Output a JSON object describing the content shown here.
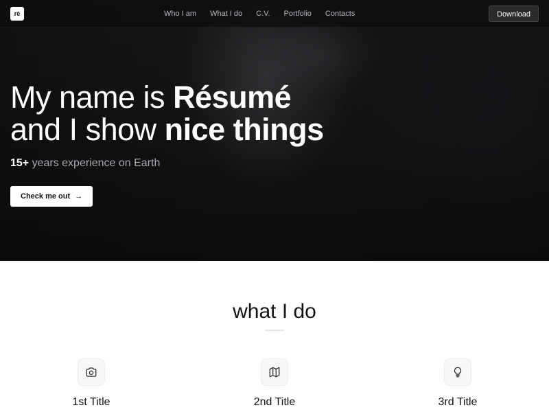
{
  "nav": {
    "logo": "ré",
    "links": [
      "Who I am",
      "What I do",
      "C.V.",
      "Portfolio",
      "Contacts"
    ],
    "download_label": "Download"
  },
  "hero": {
    "line1_prefix": "My name is ",
    "line1_bold": "Résumé",
    "line2_prefix": "and I show ",
    "line2_bold": "nice things",
    "sub_bold": "15+",
    "sub_rest": " years experience on Earth",
    "cta_label": "Check me out",
    "cta_icon": "arrow-right-icon"
  },
  "section": {
    "title": "what I do",
    "features": [
      {
        "title": "1st Title",
        "icon": "camera-icon"
      },
      {
        "title": "2nd Title",
        "icon": "map-icon"
      },
      {
        "title": "3rd Title",
        "icon": "lightbulb-icon"
      }
    ]
  }
}
